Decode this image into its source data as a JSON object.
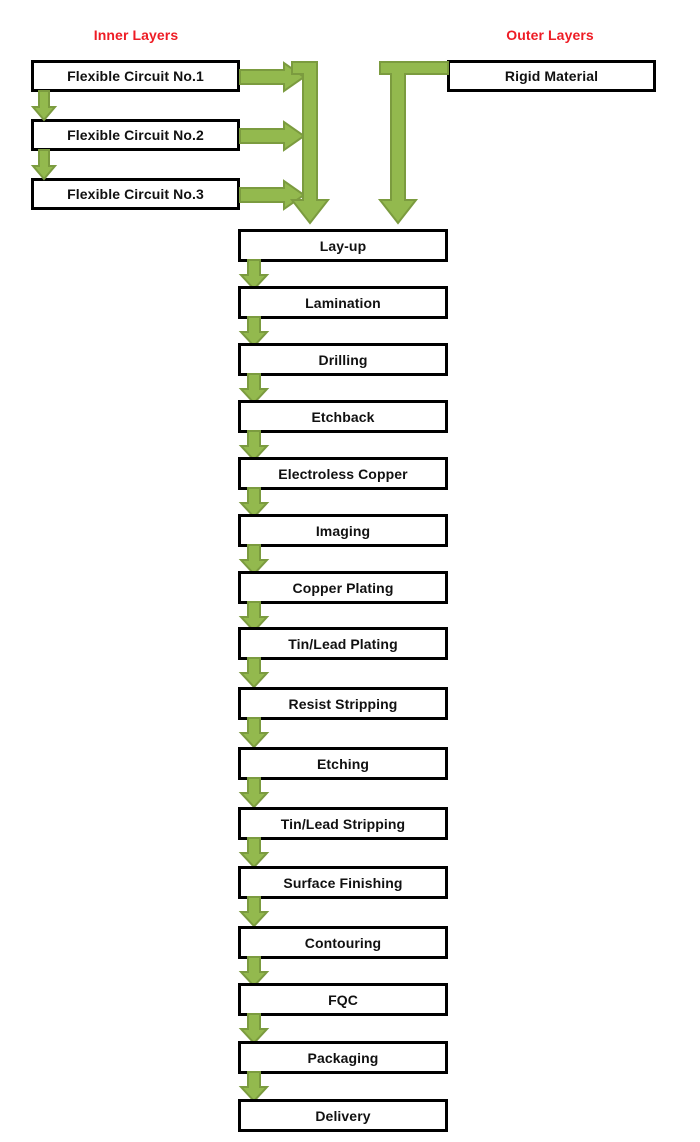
{
  "diagram": {
    "title_inner": "Inner Layers",
    "title_outer": "Outer Layers",
    "colors": {
      "heading_red": "#ee1c25",
      "arrow_fill": "#93b94e",
      "arrow_stroke": "#7b9b3f",
      "box_border": "#000000",
      "box_fill": "#ffffff",
      "text": "#111111"
    }
  },
  "inner_layers": {
    "heading": "Inner Layers",
    "boxes": [
      {
        "label": "Flexible Circuit No.1"
      },
      {
        "label": "Flexible Circuit No.2"
      },
      {
        "label": "Flexible Circuit No.3"
      }
    ]
  },
  "outer_layers": {
    "heading": "Outer Layers",
    "boxes": [
      {
        "label": "Rigid Material"
      }
    ]
  },
  "process_flow": {
    "steps": [
      {
        "index": 1,
        "label": "Lay-up"
      },
      {
        "index": 2,
        "label": "Lamination"
      },
      {
        "index": 3,
        "label": "Drilling"
      },
      {
        "index": 4,
        "label": "Etchback"
      },
      {
        "index": 5,
        "label": "Electroless Copper"
      },
      {
        "index": 6,
        "label": "Imaging"
      },
      {
        "index": 7,
        "label": "Copper Plating"
      },
      {
        "index": 8,
        "label": "Tin/Lead Plating"
      },
      {
        "index": 9,
        "label": "Resist Stripping"
      },
      {
        "index": 10,
        "label": "Etching"
      },
      {
        "index": 11,
        "label": "Tin/Lead Stripping"
      },
      {
        "index": 12,
        "label": "Surface Finishing"
      },
      {
        "index": 13,
        "label": "Contouring"
      },
      {
        "index": 14,
        "label": "FQC"
      },
      {
        "index": 15,
        "label": "Packaging"
      },
      {
        "index": 16,
        "label": "Delivery"
      }
    ]
  },
  "connectors": {
    "inner_vertical": [
      {
        "name": "fc1-to-fc2"
      },
      {
        "name": "fc2-to-fc3"
      }
    ],
    "inner_horizontal": [
      {
        "name": "fc1-to-bus"
      },
      {
        "name": "fc2-to-bus"
      },
      {
        "name": "fc3-to-bus"
      }
    ],
    "bus_left": {
      "name": "inner-bus-to-layup"
    },
    "bus_right": {
      "name": "rigid-material-to-layup"
    }
  }
}
